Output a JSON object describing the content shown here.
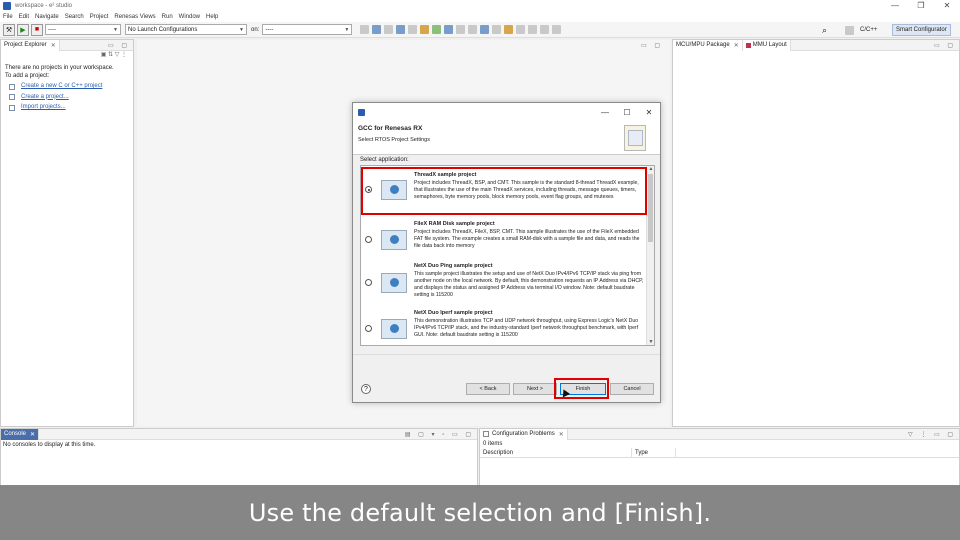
{
  "window": {
    "title": "workspace - e² studio",
    "controls": [
      "—",
      "❐",
      "✕"
    ]
  },
  "menu": [
    "File",
    "Edit",
    "Navigate",
    "Search",
    "Project",
    "Renesas Views",
    "Run",
    "Window",
    "Help"
  ],
  "toolbar": {
    "combo_left": "----",
    "launch_config": "No Launch Configurations",
    "on_label": "on:",
    "combo_target": "----",
    "perspective_cpp": "C/C++",
    "perspective_smart": "Smart Configurator"
  },
  "project_explorer": {
    "tab": "Project Explorer",
    "message_line1": "There are no projects in your workspace.",
    "message_line2": "To add a project:",
    "links": [
      "Create a new C or C++ project",
      "Create a project...",
      "Import projects..."
    ]
  },
  "right_panel": {
    "tabs": [
      "MCU/MPU Package",
      "MMU Layout"
    ]
  },
  "console": {
    "tab": "Console",
    "message": "No consoles to display at this time."
  },
  "problems": {
    "tab": "Configuration Problems",
    "count": "0 items",
    "columns": [
      "Description",
      "Type"
    ]
  },
  "dialog": {
    "title": "GCC for Renesas RX",
    "subtitle": "Select RTOS Project Settings",
    "select_label": "Select application:",
    "items": [
      {
        "title": "ThreadX sample project",
        "desc": "Project includes ThreadX, BSP, and CMT. This sample is the standard 8-thread ThreadX example, that illustrates the use of the main ThreadX services, including threads, message queues, timers, semaphores, byte memory pools, block memory pools, event flag groups, and mutexes"
      },
      {
        "title": "FileX RAM Disk sample project",
        "desc": "Project includes ThreadX, FileX, BSP, CMT. This sample illustrates the use of the FileX embedded FAT file system. The example creates a small RAM-disk with a sample file and data, and reads the file data back into memory"
      },
      {
        "title": "NetX Duo Ping sample project",
        "desc": "This sample project illustrates the setup and use of NetX Duo IPv4/IPv6 TCP/IP stack via ping from another node on the local network. By default, this demonstration requests an IP Address via DHCP, and displays the status and assigned IP Address via terminal I/O window. Note: default baudrate setting is 115200"
      },
      {
        "title": "NetX Duo Iperf sample project",
        "desc": "This demonstration illustrates TCP and UDP network throughput, using Express Logic's NetX Duo IPv4/IPv6 TCP/IP stack, and the industry-standard Iperf network throughput benchmark, with Iperf GUI. Note: default baudrate setting is 115200"
      }
    ],
    "buttons": {
      "back": "< Back",
      "next": "Next >",
      "finish": "Finish",
      "cancel": "Cancel"
    }
  },
  "caption": "Use the default selection and [Finish]."
}
